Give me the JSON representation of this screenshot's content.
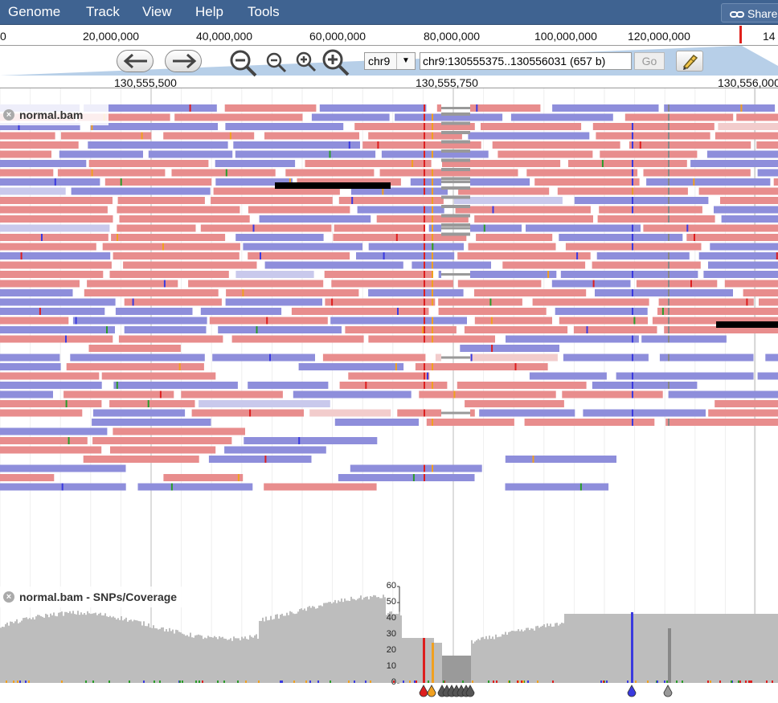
{
  "menubar": {
    "items": [
      "Genome",
      "Track",
      "View",
      "Help",
      "Tools"
    ],
    "share_label": "Share"
  },
  "overview": {
    "labels": [
      "0",
      "20,000,000",
      "40,000,000",
      "60,000,000",
      "80,000,000",
      "100,000,000",
      "120,000,000",
      "14"
    ]
  },
  "navigation": {
    "chromosome": "chr9",
    "location": "chr9:130555375..130556031 (657 b)",
    "go_label": "Go"
  },
  "ruler": {
    "labels": [
      "130,555,500",
      "130,555,750",
      "130,556,000"
    ]
  },
  "tracks": {
    "alignments_label": "normal.bam",
    "coverage_label": "normal.bam - SNPs/Coverage",
    "coverage_scale": [
      "60",
      "50",
      "40",
      "30",
      "20",
      "10",
      "0"
    ]
  },
  "colors": {
    "menubar": "#3f6391",
    "forward_read": "#e88d8d",
    "reverse_read": "#8e8edb",
    "coverage": "#bdbdbd",
    "deletion": "#999999",
    "snp_red": "#dd1f1f",
    "snp_orange": "#f0a020",
    "snp_blue": "#3a3adf",
    "snp_green": "#2a9b2a"
  },
  "icons": [
    "link-icon",
    "left-arrow-icon",
    "right-arrow-icon",
    "zoom-out-large-icon",
    "zoom-out-small-icon",
    "zoom-in-small-icon",
    "zoom-in-large-icon",
    "chevron-down-icon",
    "highlighter-icon",
    "close-icon",
    "snp-marker-icon"
  ]
}
